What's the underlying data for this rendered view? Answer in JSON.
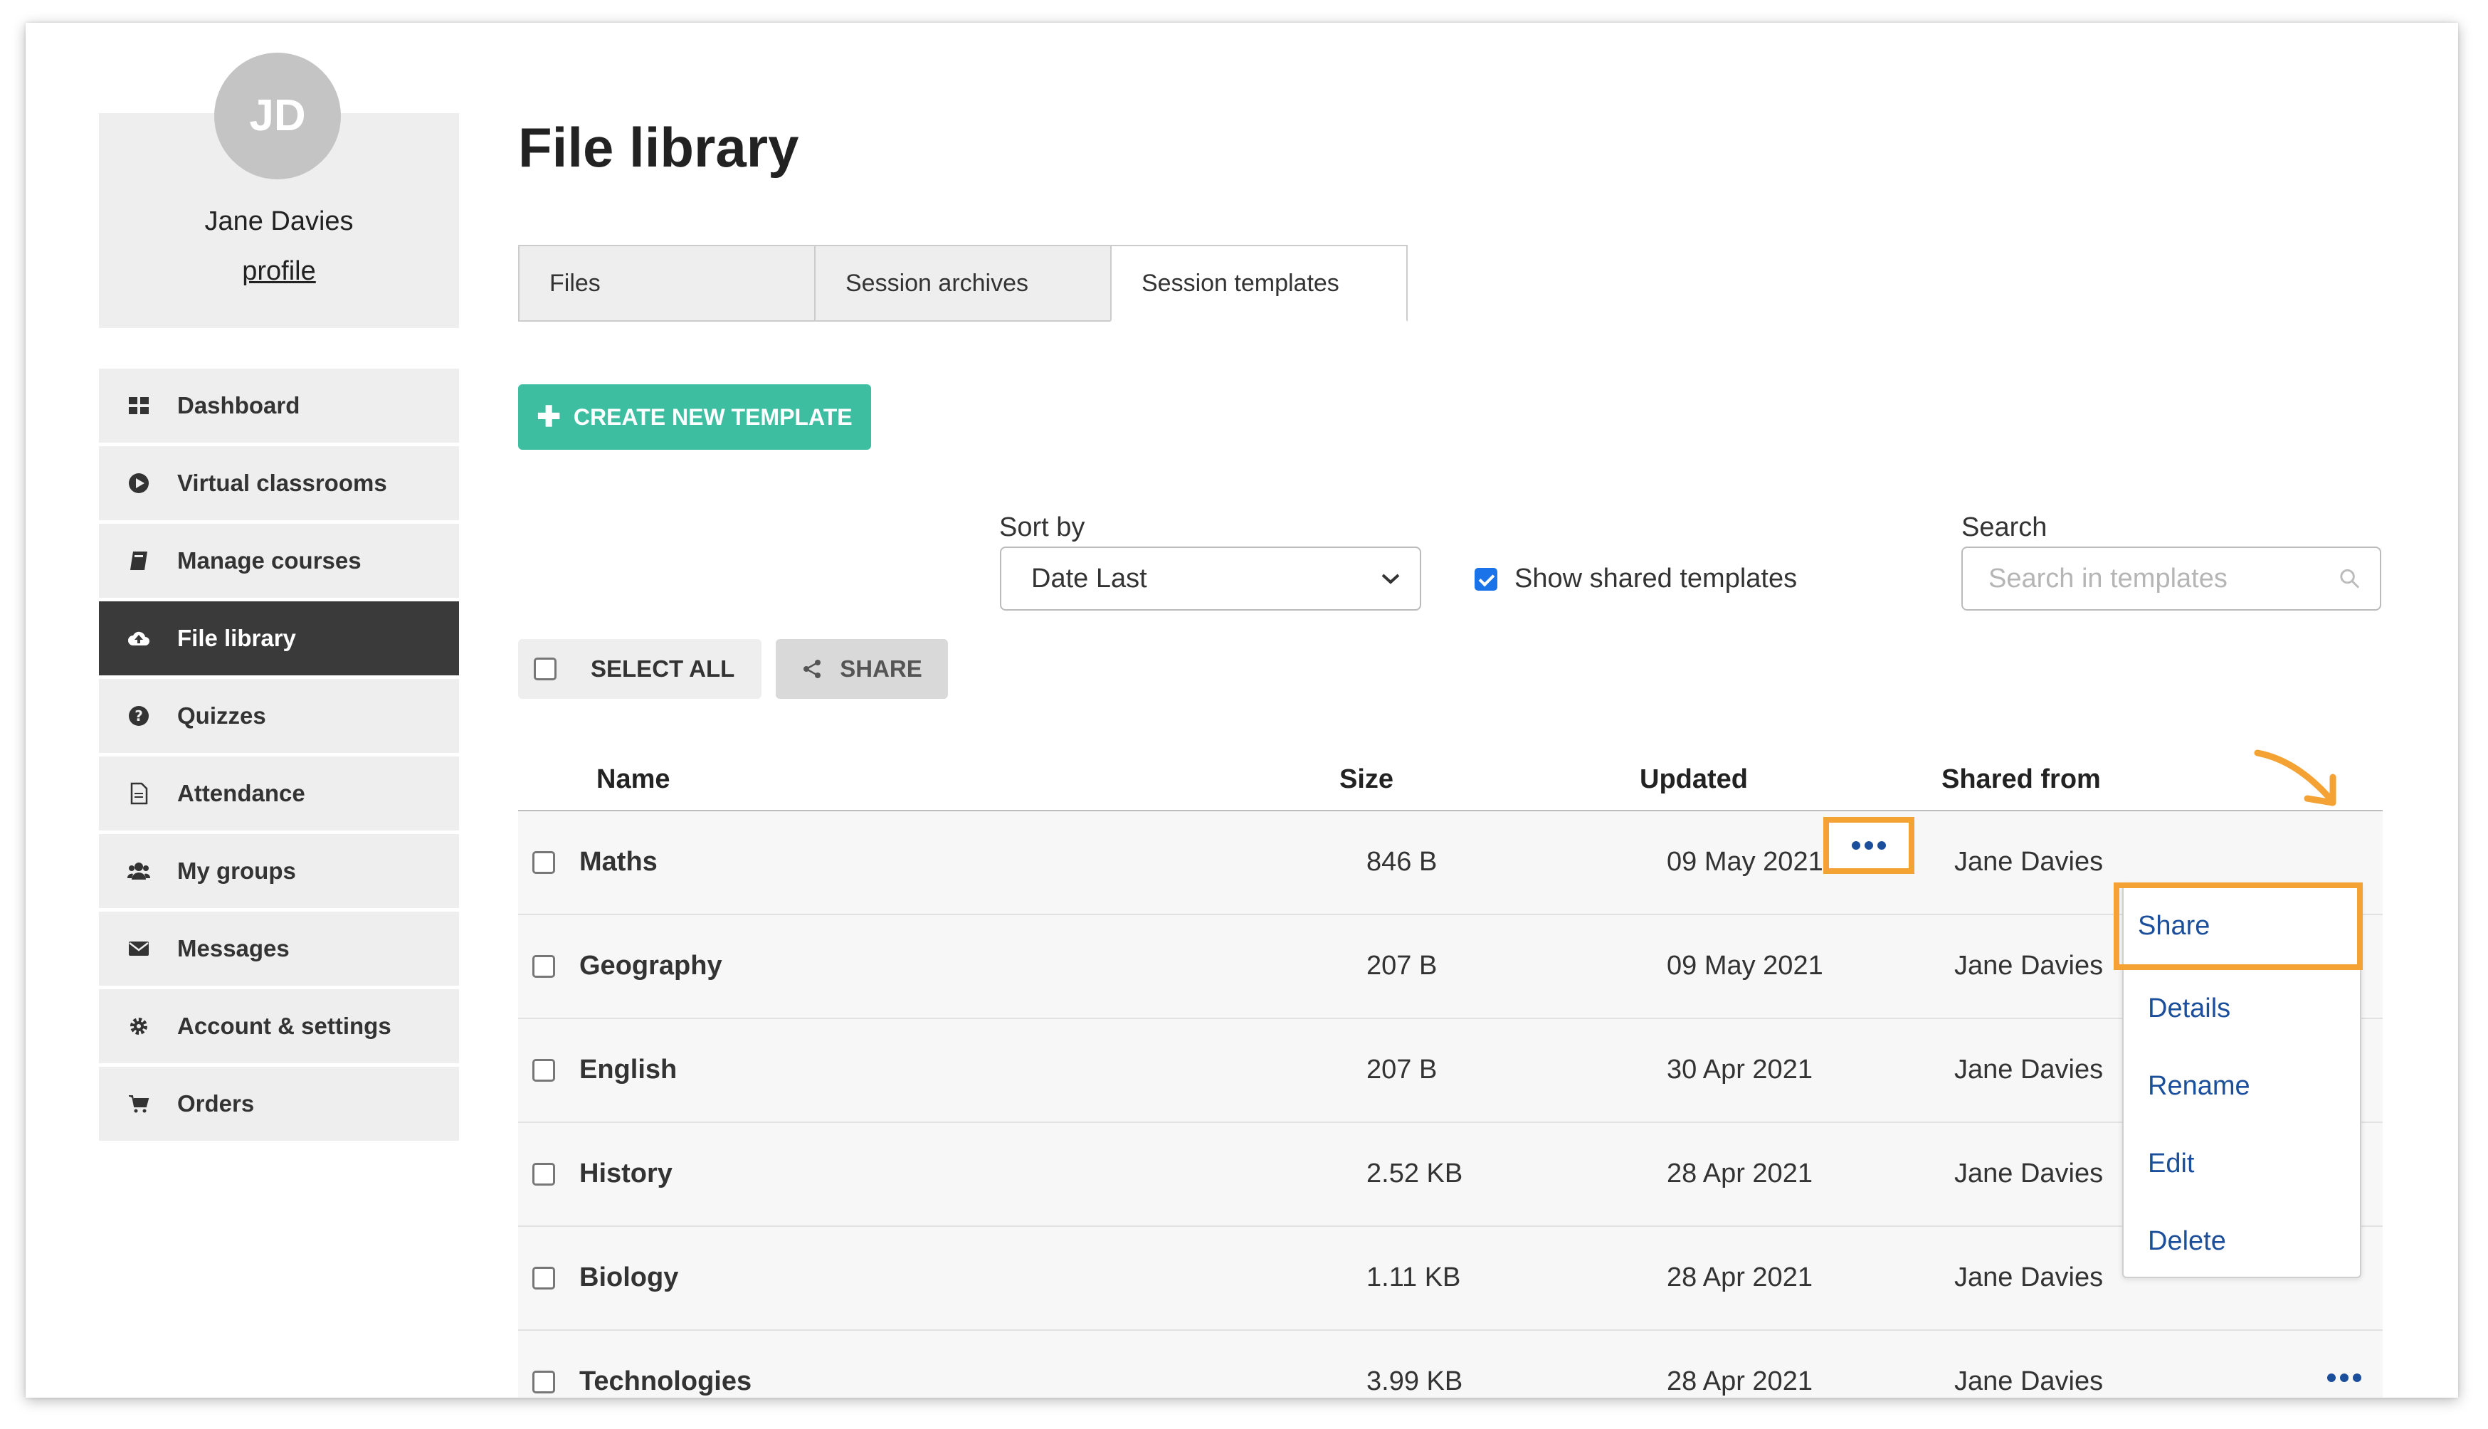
{
  "profile": {
    "initials": "JD",
    "name": "Jane Davies",
    "link": "profile"
  },
  "nav": [
    {
      "label": "Dashboard",
      "icon": "dashboard-icon"
    },
    {
      "label": "Virtual classrooms",
      "icon": "play-circle-icon"
    },
    {
      "label": "Manage courses",
      "icon": "book-icon"
    },
    {
      "label": "File library",
      "icon": "cloud-upload-icon",
      "active": true
    },
    {
      "label": "Quizzes",
      "icon": "question-circle-icon"
    },
    {
      "label": "Attendance",
      "icon": "document-icon"
    },
    {
      "label": "My groups",
      "icon": "users-icon"
    },
    {
      "label": "Messages",
      "icon": "envelope-icon"
    },
    {
      "label": "Account & settings",
      "icon": "gear-icon"
    },
    {
      "label": "Orders",
      "icon": "cart-icon"
    }
  ],
  "page": {
    "title": "File library"
  },
  "tabs": [
    {
      "label": "Files"
    },
    {
      "label": "Session archives"
    },
    {
      "label": "Session templates",
      "active": true
    }
  ],
  "toolbar": {
    "create_label": "CREATE NEW TEMPLATE",
    "sort_label": "Sort by",
    "sort_value": "Date Last",
    "show_shared_label": "Show shared templates",
    "show_shared_checked": true,
    "search_label": "Search",
    "search_placeholder": "Search in templates",
    "select_all_label": "SELECT ALL",
    "share_label": "SHARE"
  },
  "table": {
    "headers": {
      "name": "Name",
      "size": "Size",
      "updated": "Updated",
      "shared": "Shared from"
    },
    "rows": [
      {
        "name": "Maths",
        "size": "846 B",
        "updated": "09 May 2021",
        "shared": "Jane Davies"
      },
      {
        "name": "Geography",
        "size": "207 B",
        "updated": "09 May 2021",
        "shared": "Jane Davies"
      },
      {
        "name": "English",
        "size": "207 B",
        "updated": "30 Apr 2021",
        "shared": "Jane Davies"
      },
      {
        "name": "History",
        "size": "2.52 KB",
        "updated": "28 Apr 2021",
        "shared": "Jane Davies"
      },
      {
        "name": "Biology",
        "size": "1.11 KB",
        "updated": "28 Apr 2021",
        "shared": "Jane Davies"
      },
      {
        "name": "Technologies",
        "size": "3.99 KB",
        "updated": "28 Apr 2021",
        "shared": "Jane Davies"
      }
    ]
  },
  "dropdown": {
    "items": [
      "Share",
      "Details",
      "Rename",
      "Edit",
      "Delete"
    ]
  },
  "colors": {
    "accent": "#3dbea0",
    "highlight": "#f3a233",
    "link": "#1b4f9b",
    "active_nav": "#3a3a3a"
  }
}
